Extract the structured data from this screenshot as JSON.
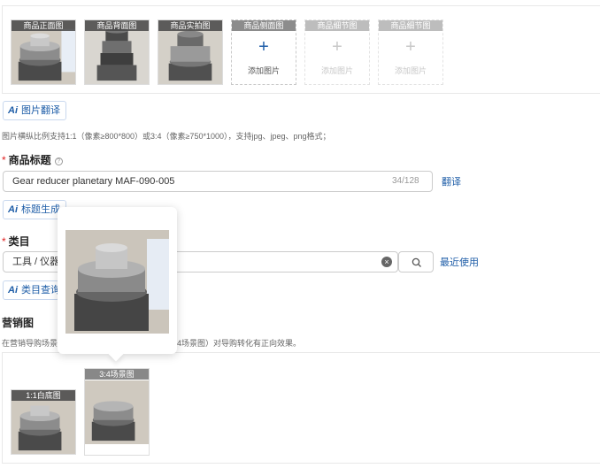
{
  "product_images": {
    "slots": [
      {
        "caption": "商品正面图",
        "filled": true
      },
      {
        "caption": "商品背面图",
        "filled": true
      },
      {
        "caption": "商品实拍图",
        "filled": true
      },
      {
        "caption": "商品侧面图",
        "filled": false,
        "add_label": "添加图片"
      },
      {
        "caption": "商品细节图",
        "filled": false,
        "add_label": "添加图片"
      },
      {
        "caption": "商品细节图",
        "filled": false,
        "add_label": "添加图片"
      }
    ],
    "translate_button": "图片翻译",
    "hint": "图片横纵比例支持1:1（像素≥800*800）或3:4（像素≥750*1000），支持jpg、jpeg、png格式；"
  },
  "title_field": {
    "label": "商品标题",
    "value": "Gear reducer planetary MAF-090-005",
    "counter": "34/128",
    "translate_link": "翻译",
    "generate_button": "标题生成"
  },
  "category_field": {
    "label": "类目",
    "value": "工具 / 仪器",
    "recent_link": "最近使用",
    "query_button": "类目查询"
  },
  "marketing": {
    "label": "营销图",
    "hint_left": "在营销导购场景",
    "hint_right": "4场景图）对导购转化有正向效果。",
    "slots": [
      {
        "caption": "1:1白底图"
      },
      {
        "caption": "3:4场景图"
      }
    ]
  },
  "ai_badge": "Ai",
  "icons": {
    "plus": "+",
    "clear": "×",
    "help": "?"
  },
  "colors": {
    "accent": "#1f5ea8",
    "required": "#e02020"
  }
}
